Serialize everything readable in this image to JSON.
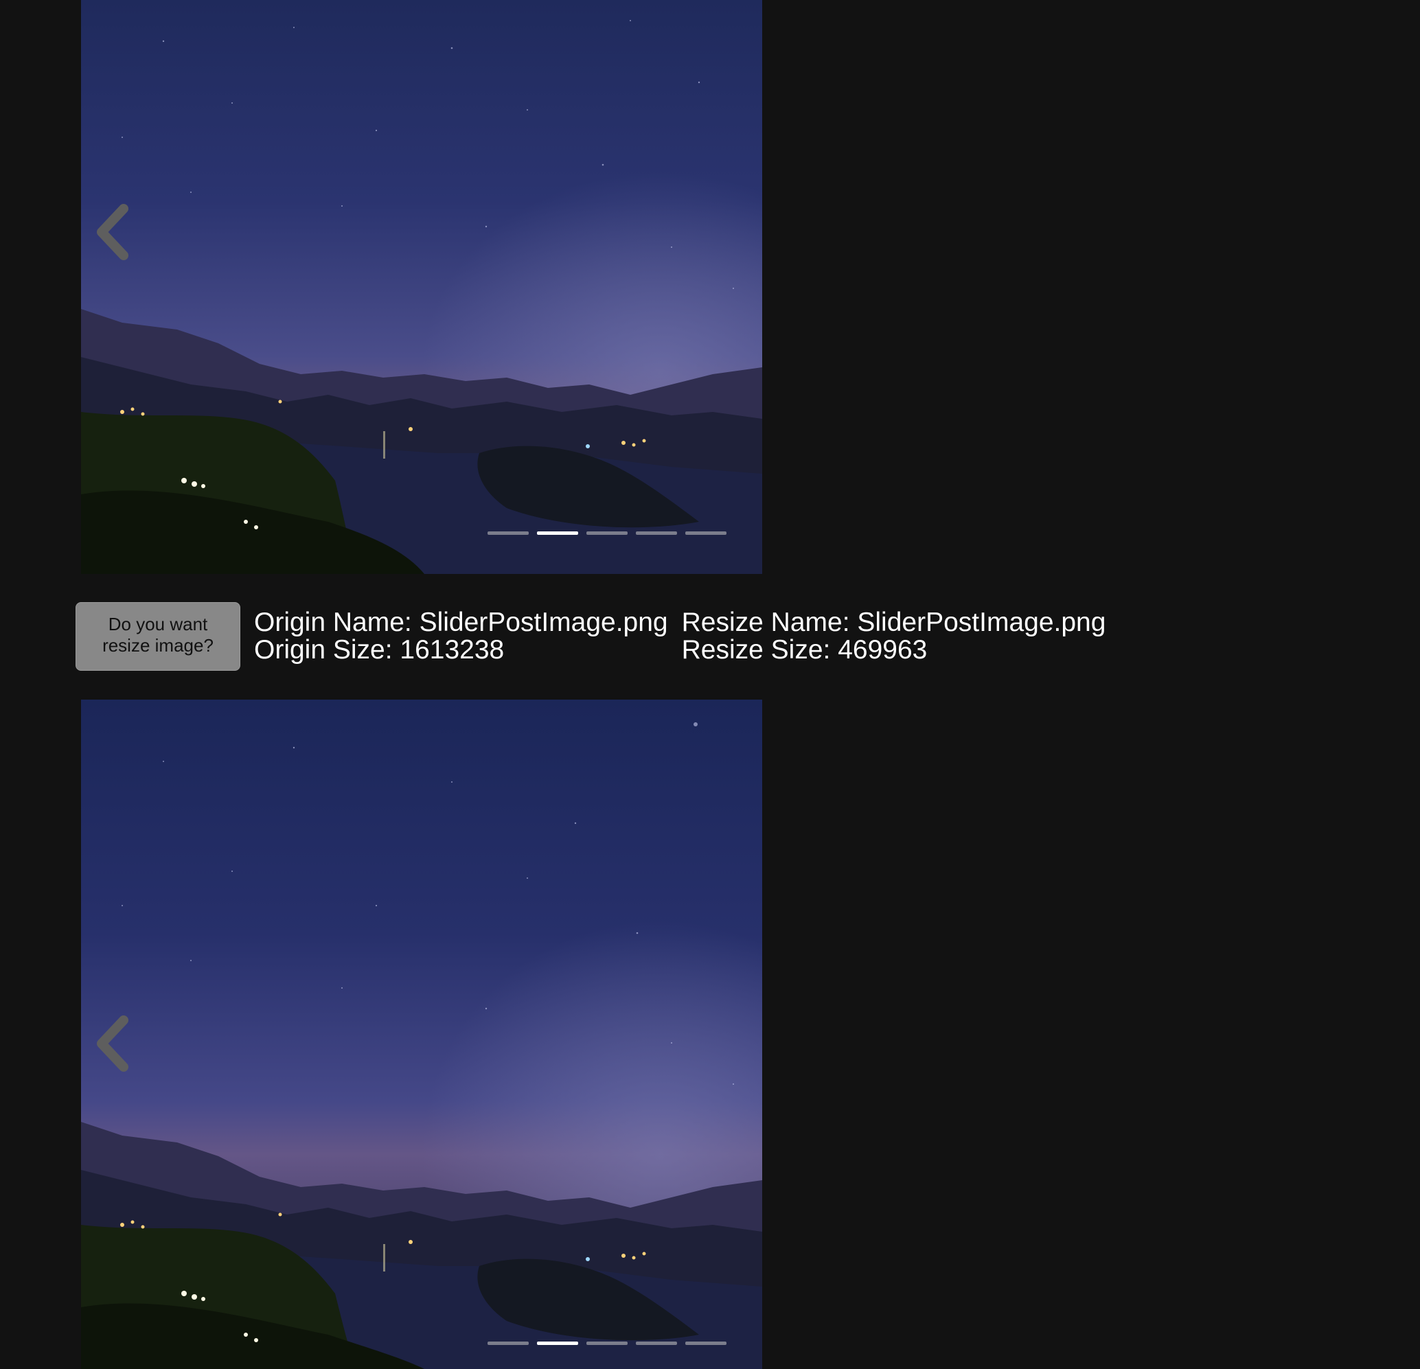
{
  "sliders": [
    {
      "active_slide": 2,
      "slide_count": 5
    },
    {
      "active_slide": 2,
      "slide_count": 5
    }
  ],
  "icons": {
    "prev": "chevron-left-icon"
  },
  "resize_button": {
    "label": "Do you want resize image?"
  },
  "origin": {
    "name_line": "Origin Name: SliderPostImage.png",
    "size_line": "Origin Size: 1613238"
  },
  "resize": {
    "name_line": "Resize Name: SliderPostImage.png",
    "size_line": "Resize Size: 469963"
  },
  "colors": {
    "background": "#121212",
    "button": "#888888",
    "text": "#ffffff",
    "dot_active": "#ffffff",
    "dot_inactive": "#c8c8c8"
  }
}
